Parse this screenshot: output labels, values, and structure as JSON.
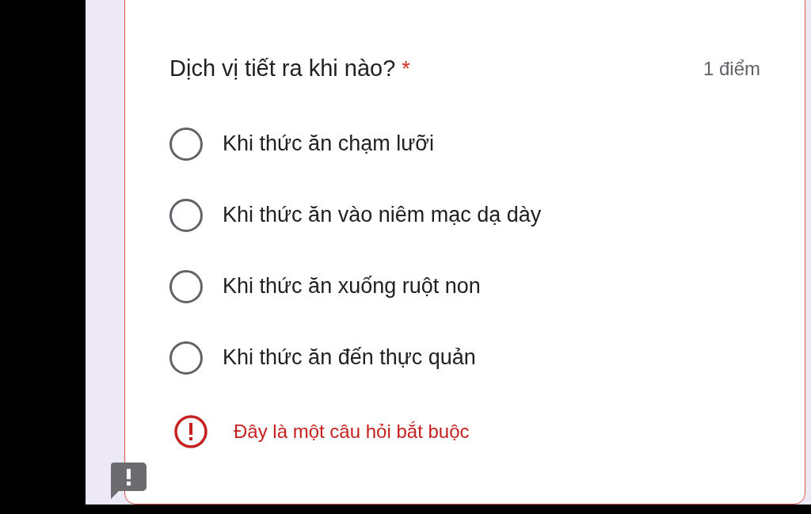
{
  "question": {
    "title": "Dịch vị tiết ra khi nào?",
    "required_mark": "*",
    "points": "1 điểm"
  },
  "options": [
    {
      "label": "Khi thức ăn chạm lưỡi",
      "selected": false
    },
    {
      "label": "Khi thức ăn vào niêm mạc dạ dày",
      "selected": false
    },
    {
      "label": "Khi thức ăn xuống ruột non",
      "selected": false
    },
    {
      "label": "Khi thức ăn đến thực quản",
      "selected": false
    }
  ],
  "error": {
    "text": "Đây là một câu hỏi bắt buộc"
  }
}
